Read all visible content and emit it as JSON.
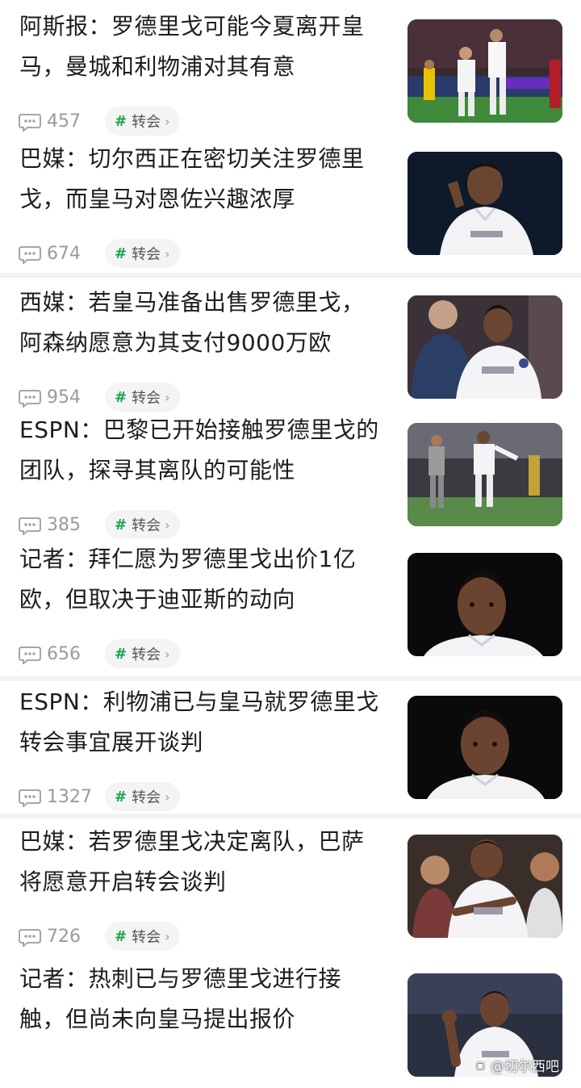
{
  "tag_label": "转会",
  "tag_hash": "#",
  "tag_chevron": "›",
  "watermark": "@切尔西吧",
  "colors": {
    "tag_hash": "#1aa34a",
    "count": "#9a9a9a",
    "tag_bg": "#f4f4f4",
    "divider": "#f2f2f2"
  },
  "articles": [
    {
      "line1": "阿斯报：罗德里戈可能今夏离开皇",
      "line2": "马，曼城和利物浦对其有意",
      "comments": "457"
    },
    {
      "line1": "巴媒：切尔西正在密切关注罗德里",
      "line2": "戈，而皇马对恩佐兴趣浓厚",
      "comments": "674"
    },
    {
      "line1": "西媒：若皇马准备出售罗德里戈，",
      "line2": "阿森纳愿意为其支付9000万欧",
      "comments": "954"
    },
    {
      "line1": "ESPN：巴黎已开始接触罗德里戈的",
      "line2": "团队，探寻其离队的可能性",
      "comments": "385"
    },
    {
      "line1": "记者：拜仁愿为罗德里戈出价1亿",
      "line2": "欧，但取决于迪亚斯的动向",
      "comments": "656"
    },
    {
      "line1": "ESPN：利物浦已与皇马就罗德里戈",
      "line2": "转会事宜展开谈判",
      "comments": "1327"
    },
    {
      "line1": "巴媒：若罗德里戈决定离队，巴萨",
      "line2": "将愿意开启转会谈判",
      "comments": "726"
    },
    {
      "line1": "记者：热刺已与罗德里戈进行接",
      "line2": "触，但尚未向皇马提出报价",
      "comments": ""
    }
  ]
}
